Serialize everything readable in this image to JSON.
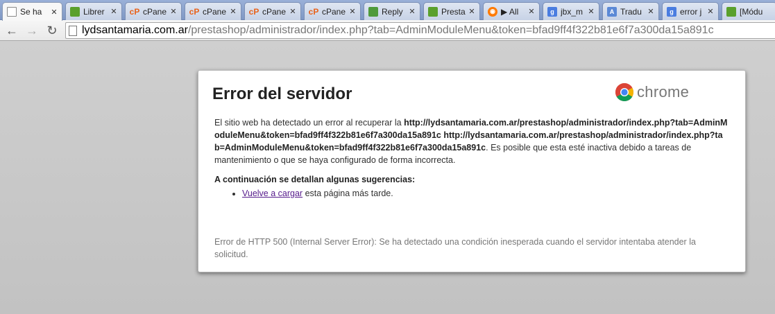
{
  "tabs": [
    {
      "label": "Se ha",
      "favicon": "doc-icon",
      "close": "✕",
      "active": true
    },
    {
      "label": "Librer",
      "favicon": "shop-icon"
    },
    {
      "label": "cPane",
      "favicon": "cpanel-icon"
    },
    {
      "label": "cPane",
      "favicon": "cpanel-icon"
    },
    {
      "label": "cPane",
      "favicon": "cpanel-icon"
    },
    {
      "label": "cPane",
      "favicon": "cpanel-icon"
    },
    {
      "label": "Reply",
      "favicon": "reply-icon"
    },
    {
      "label": "Presta",
      "favicon": "shop-icon"
    },
    {
      "label": "▶ All",
      "favicon": "play-icon"
    },
    {
      "label": "jbx_m",
      "favicon": "google-icon"
    },
    {
      "label": "Tradu",
      "favicon": "translate-icon"
    },
    {
      "label": "error j",
      "favicon": "google-icon"
    },
    {
      "label": "[Módu",
      "favicon": "shop-icon"
    }
  ],
  "toolbar": {
    "back_icon": "←",
    "forward_icon": "→",
    "reload_icon": "↻",
    "url_host": "lydsantamaria.com.ar",
    "url_path": "/prestashop/administrador/index.php?tab=AdminModuleMenu&token=bfad9ff4f322b81e6f7a300da15a891c"
  },
  "error_page": {
    "title": "Error del servidor",
    "logo_text": "chrome",
    "intro": "El sitio web ha detectado un error al recuperar la ",
    "url_bold_1": "http://lydsantamaria.com.ar/prestashop/administrador/index.php?tab=AdminModuleMenu&token=bfad9ff4f322b81e6f7a300da15a891c",
    "url_bold_2": "http://lydsantamaria.com.ar/prestashop/administrador/index.php?tab=AdminModuleMenu&token=bfad9ff4f322b81e6f7a300da15a891c",
    "intro_tail": ". Es posible que esta esté inactiva debido a tareas de mantenimiento o que se haya configurado de forma incorrecta.",
    "suggestions_heading": "A continuación se detallan algunas sugerencias:",
    "suggestion_link": "Vuelve a cargar",
    "suggestion_tail": " esta página más tarde.",
    "error_code": "Error de HTTP 500 (Internal Server Error): Se ha detectado una condición inesperada cuando el servidor intentaba atender la solicitud."
  },
  "colors": {
    "link_visited": "#551a8b",
    "url_path": "#777777",
    "background": "#c8c8c8"
  }
}
